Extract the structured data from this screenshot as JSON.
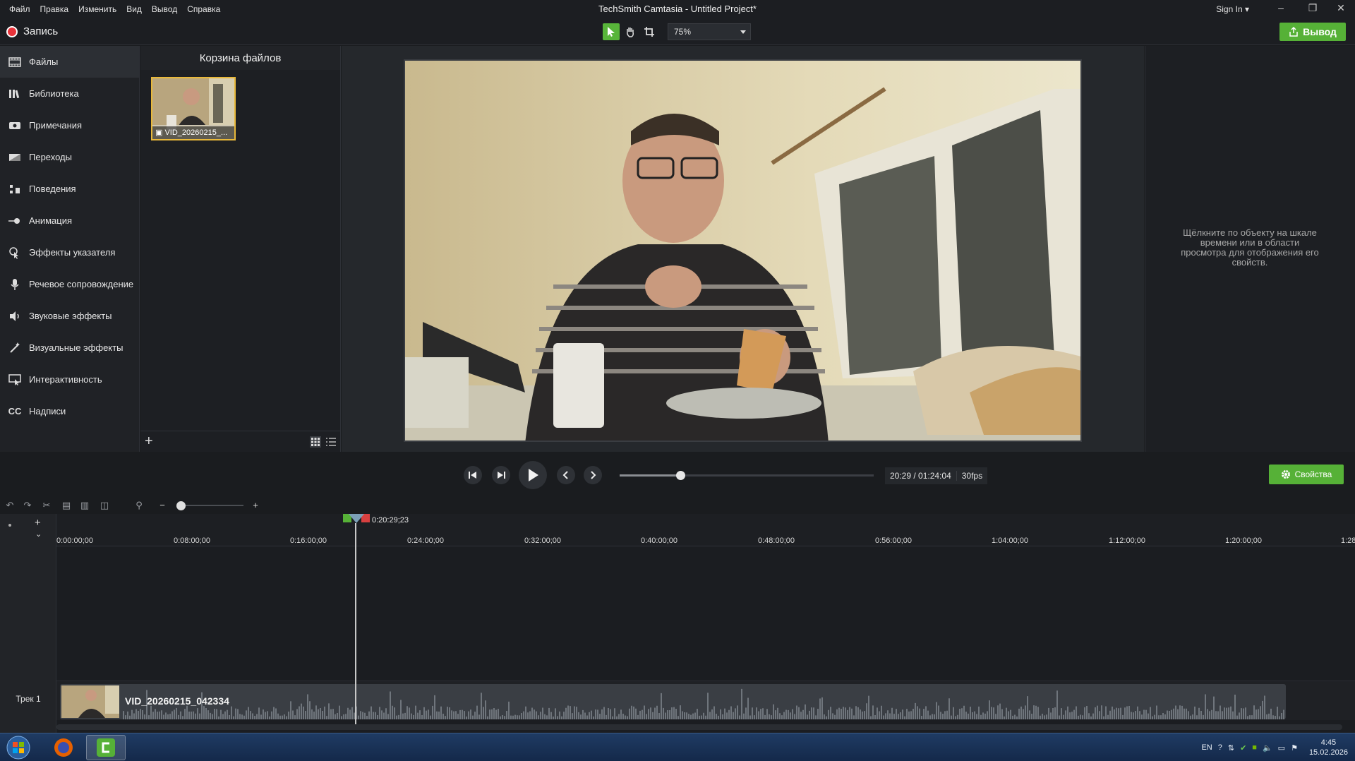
{
  "window": {
    "title": "TechSmith Camtasia - Untitled Project*",
    "menu": [
      "Файл",
      "Правка",
      "Изменить",
      "Вид",
      "Вывод",
      "Справка"
    ],
    "sign_in": "Sign In"
  },
  "toolbar": {
    "record_label": "Запись",
    "zoom": "75%",
    "export_label": "Вывод"
  },
  "sidebar": {
    "items": [
      {
        "label": "Файлы",
        "icon": "film-icon"
      },
      {
        "label": "Библиотека",
        "icon": "library-icon"
      },
      {
        "label": "Примечания",
        "icon": "annotation-icon"
      },
      {
        "label": "Переходы",
        "icon": "transition-icon"
      },
      {
        "label": "Поведения",
        "icon": "behavior-icon"
      },
      {
        "label": "Анимация",
        "icon": "animation-icon"
      },
      {
        "label": "Эффекты указателя",
        "icon": "cursor-icon"
      },
      {
        "label": "Речевое сопровождение",
        "icon": "microphone-icon"
      },
      {
        "label": "Звуковые эффекты",
        "icon": "speaker-icon"
      },
      {
        "label": "Визуальные эффекты",
        "icon": "wand-icon"
      },
      {
        "label": "Интерактивность",
        "icon": "interactive-icon"
      },
      {
        "label": "Надписи",
        "icon": "cc-icon"
      }
    ]
  },
  "media_bin": {
    "title": "Корзина файлов",
    "items": [
      {
        "name": "VID_20260215_..."
      }
    ]
  },
  "properties": {
    "hint": "Щёлкните по объекту на шкале времени или в области просмотра для отображения его свойств.",
    "button_label": "Свойства"
  },
  "transport": {
    "time": "20:29 / 01:24:04",
    "fps": "30fps",
    "progress": 0.24
  },
  "timeline": {
    "playhead": "0:20:29;23",
    "ruler": [
      "0:00:00;00",
      "0:08:00;00",
      "0:16:00;00",
      "0:24:00;00",
      "0:32:00;00",
      "0:40:00;00",
      "0:48:00;00",
      "0:56:00;00",
      "1:04:00;00",
      "1:12:00;00",
      "1:20:00;00",
      "1:28"
    ],
    "track_label": "Трек 1",
    "clip_name": "VID_20260215_042334"
  },
  "taskbar": {
    "lang": "EN",
    "time": "4:45",
    "date": "15.02.2026"
  },
  "colors": {
    "accent": "#56b137",
    "record": "#e8333a",
    "selection": "#e8b83a"
  }
}
